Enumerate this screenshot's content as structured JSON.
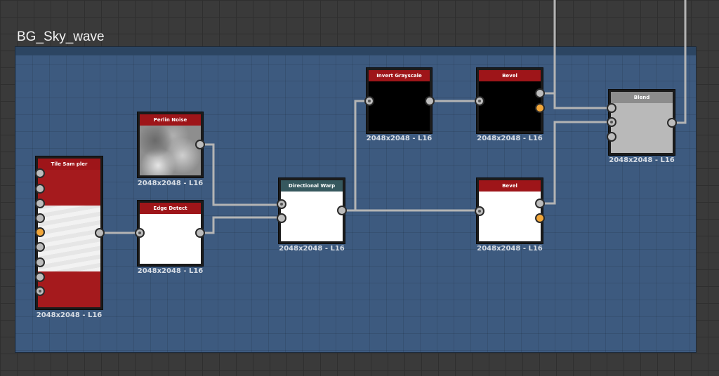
{
  "frame": {
    "title": "BG_Sky_wave"
  },
  "nodes": {
    "tile_sampler": {
      "title": "Tile Sam pler",
      "res": "2048x2048 - L16"
    },
    "perlin_noise": {
      "title": "Perlin Noise",
      "res": "2048x2048 - L16"
    },
    "edge_detect": {
      "title": "Edge Detect",
      "res": "2048x2048 - L16"
    },
    "directional_warp": {
      "title": "Directional Warp",
      "res": "2048x2048 - L16"
    },
    "invert_grayscale": {
      "title": "Invert Grayscale",
      "res": "2048x2048 - L16"
    },
    "bevel_top": {
      "title": "Bevel",
      "res": "2048x2048 - L16"
    },
    "bevel_bottom": {
      "title": "Bevel",
      "res": "2048x2048 - L16"
    },
    "blend": {
      "title": "Blend",
      "res": "2048x2048 - L16"
    }
  },
  "colors": {
    "canvas_bg": "#3a3a3a",
    "frame_bg": "#3d5a7f",
    "node_header_red": "#9e1519",
    "node_header_teal": "#36585e",
    "node_header_gray": "#8c8c8c",
    "wire": "#b4b4b4",
    "port_default": "#bdbdbd",
    "port_orange": "#f2a73a"
  }
}
